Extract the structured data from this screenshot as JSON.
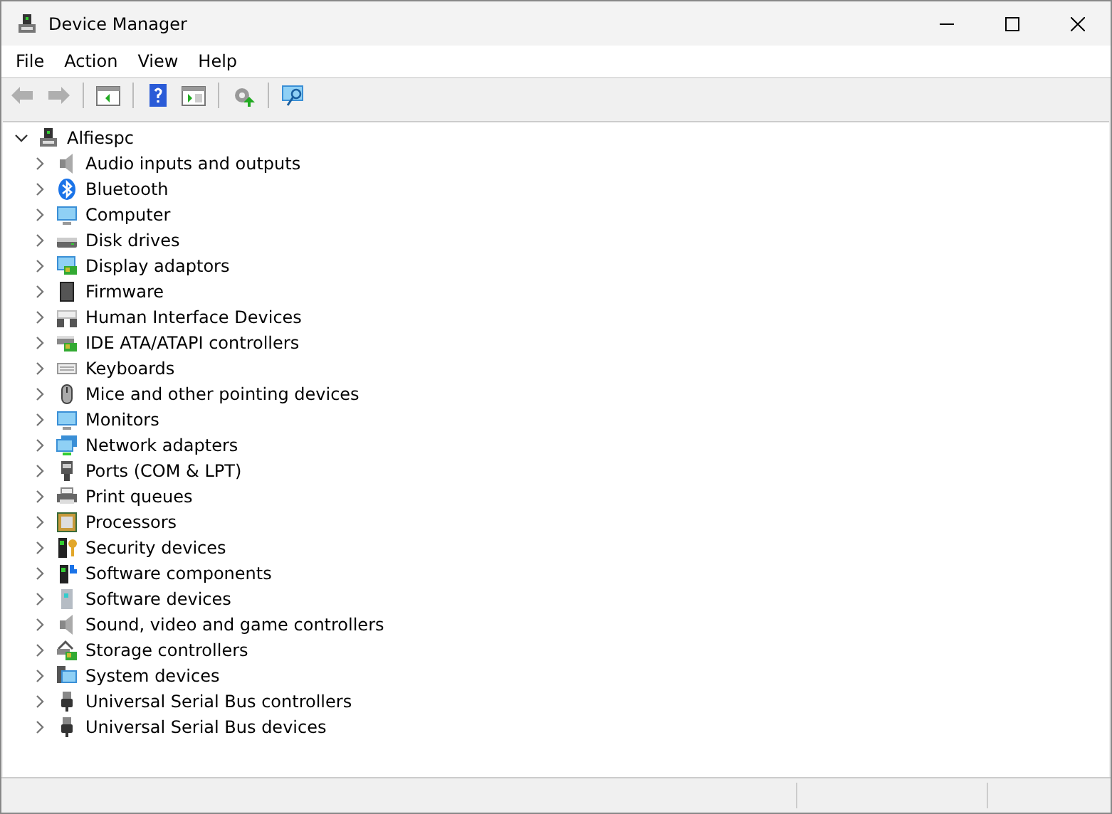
{
  "window": {
    "title": "Device Manager"
  },
  "menu": [
    "File",
    "Action",
    "View",
    "Help"
  ],
  "toolbar": [
    {
      "kind": "back",
      "disabled": true
    },
    {
      "kind": "forward",
      "disabled": true
    },
    {
      "kind": "panel",
      "disabled": false
    },
    {
      "kind": "help",
      "disabled": false
    },
    {
      "kind": "panel2",
      "disabled": false
    },
    {
      "kind": "update",
      "disabled": false
    },
    {
      "kind": "scan",
      "disabled": false
    }
  ],
  "tree": {
    "label": "Alfiespc",
    "kind": "pc",
    "expanded": true,
    "children": [
      {
        "label": "Audio inputs and outputs",
        "kind": "speaker",
        "expanded": false
      },
      {
        "label": "Bluetooth",
        "kind": "bluetooth",
        "expanded": false
      },
      {
        "label": "Computer",
        "kind": "monitor",
        "expanded": false
      },
      {
        "label": "Disk drives",
        "kind": "drive",
        "expanded": false
      },
      {
        "label": "Display adaptors",
        "kind": "card",
        "expanded": false
      },
      {
        "label": "Firmware",
        "kind": "chip",
        "expanded": false
      },
      {
        "label": "Human Interface Devices",
        "kind": "hid",
        "expanded": false
      },
      {
        "label": "IDE ATA/ATAPI controllers",
        "kind": "ide",
        "expanded": false
      },
      {
        "label": "Keyboards",
        "kind": "keyboard",
        "expanded": false
      },
      {
        "label": "Mice and other pointing devices",
        "kind": "mouse",
        "expanded": false
      },
      {
        "label": "Monitors",
        "kind": "monitor",
        "expanded": false
      },
      {
        "label": "Network adapters",
        "kind": "network",
        "expanded": false
      },
      {
        "label": "Ports (COM & LPT)",
        "kind": "port",
        "expanded": false
      },
      {
        "label": "Print queues",
        "kind": "printer",
        "expanded": false
      },
      {
        "label": "Processors",
        "kind": "cpu",
        "expanded": false
      },
      {
        "label": "Security devices",
        "kind": "key",
        "expanded": false
      },
      {
        "label": "Software components",
        "kind": "component",
        "expanded": false
      },
      {
        "label": "Software devices",
        "kind": "tower",
        "expanded": false
      },
      {
        "label": "Sound, video and game controllers",
        "kind": "speaker",
        "expanded": false
      },
      {
        "label": "Storage controllers",
        "kind": "storage",
        "expanded": false
      },
      {
        "label": "System devices",
        "kind": "system",
        "expanded": false
      },
      {
        "label": "Universal Serial Bus controllers",
        "kind": "usb",
        "expanded": false
      },
      {
        "label": "Universal Serial Bus devices",
        "kind": "usb",
        "expanded": false
      }
    ]
  }
}
